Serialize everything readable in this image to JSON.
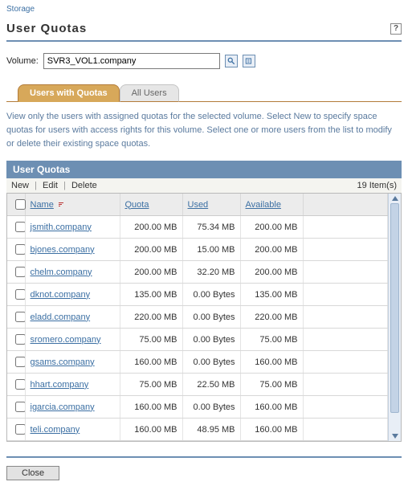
{
  "nav": {
    "breadcrumb": "Storage"
  },
  "page": {
    "title": "User Quotas",
    "help_tooltip": "Help"
  },
  "volume": {
    "label": "Volume:",
    "value": "SVR3_VOL1.company"
  },
  "tabs": {
    "active": "Users with Quotas",
    "inactive": "All Users"
  },
  "description": "View only the users with assigned quotas for the selected volume. Select New to specify space quotas for users with access rights for this volume. Select one or more users from the list to modify or delete their existing space quotas.",
  "panel": {
    "title": "User Quotas",
    "actions": {
      "new": "New",
      "edit": "Edit",
      "delete": "Delete"
    },
    "item_count": "19 Item(s)"
  },
  "columns": {
    "name": "Name",
    "quota": "Quota",
    "used": "Used",
    "available": "Available"
  },
  "rows": [
    {
      "name": "jsmith.company",
      "quota": "200.00 MB",
      "used": "75.34 MB",
      "available": "200.00 MB"
    },
    {
      "name": "bjones.company",
      "quota": "200.00 MB",
      "used": "15.00 MB",
      "available": "200.00 MB"
    },
    {
      "name": "chelm.company",
      "quota": "200.00 MB",
      "used": "32.20 MB",
      "available": "200.00 MB"
    },
    {
      "name": "dknot.company",
      "quota": "135.00 MB",
      "used": "0.00 Bytes",
      "available": "135.00 MB"
    },
    {
      "name": "eladd.company",
      "quota": "220.00 MB",
      "used": "0.00 Bytes",
      "available": "220.00 MB"
    },
    {
      "name": "sromero.company",
      "quota": "75.00 MB",
      "used": "0.00 Bytes",
      "available": "75.00 MB"
    },
    {
      "name": "gsams.company",
      "quota": "160.00 MB",
      "used": "0.00 Bytes",
      "available": "160.00 MB"
    },
    {
      "name": "hhart.company",
      "quota": "75.00 MB",
      "used": "22.50 MB",
      "available": "75.00 MB"
    },
    {
      "name": "igarcia.company",
      "quota": "160.00 MB",
      "used": "0.00 Bytes",
      "available": "160.00 MB"
    },
    {
      "name": "teli.company",
      "quota": "160.00 MB",
      "used": "48.95 MB",
      "available": "160.00 MB"
    }
  ],
  "footer": {
    "close": "Close"
  }
}
